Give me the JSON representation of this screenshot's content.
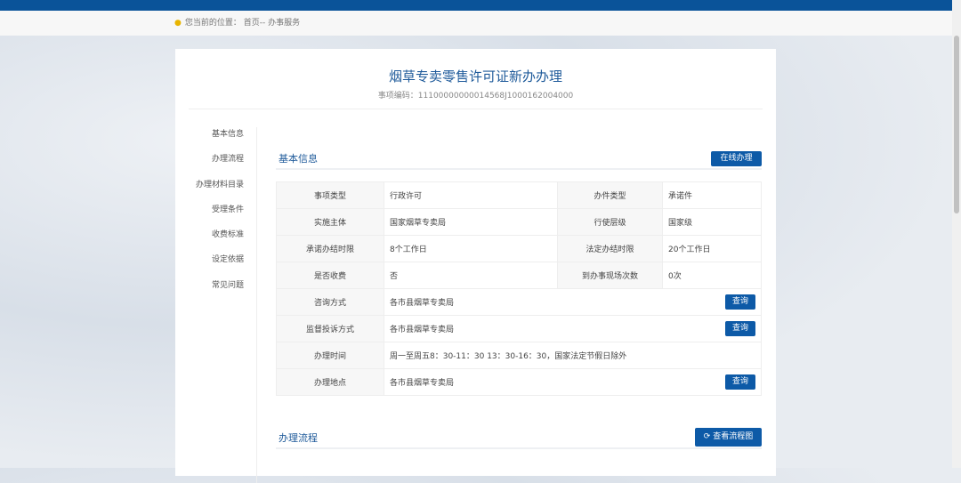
{
  "breadcrumb": {
    "prefix": "您当前的位置：",
    "path": "首页-- 办事服务"
  },
  "page": {
    "title": "烟草专卖零售许可证新办办理",
    "code": "事项编码：11100000000014568J1000162004000"
  },
  "sidebar": [
    "基本信息",
    "办理流程",
    "办理材料目录",
    "受理条件",
    "收费标准",
    "设定依据",
    "常见问题"
  ],
  "basic": {
    "heading": "基本信息",
    "online_button": "在线办理",
    "pairs": [
      [
        "事项类型",
        "行政许可",
        "办件类型",
        "承诺件"
      ],
      [
        "实施主体",
        "国家烟草专卖局",
        "行使层级",
        "国家级"
      ],
      [
        "承诺办结时限",
        "8个工作日",
        "法定办结时限",
        "20个工作日"
      ],
      [
        "是否收费",
        "否",
        "到办事现场次数",
        "0次"
      ]
    ],
    "rows": [
      [
        "咨询方式",
        "各市县烟草专卖局",
        "查询"
      ],
      [
        "监督投诉方式",
        "各市县烟草专卖局",
        "查询"
      ],
      [
        "办理时间",
        "周一至周五8：30-11：30 13：30-16：30，国家法定节假日除外",
        null
      ],
      [
        "办理地点",
        "各市县烟草专卖局",
        "查询"
      ]
    ]
  },
  "process": {
    "heading": "办理流程",
    "button": "查看流程图"
  }
}
